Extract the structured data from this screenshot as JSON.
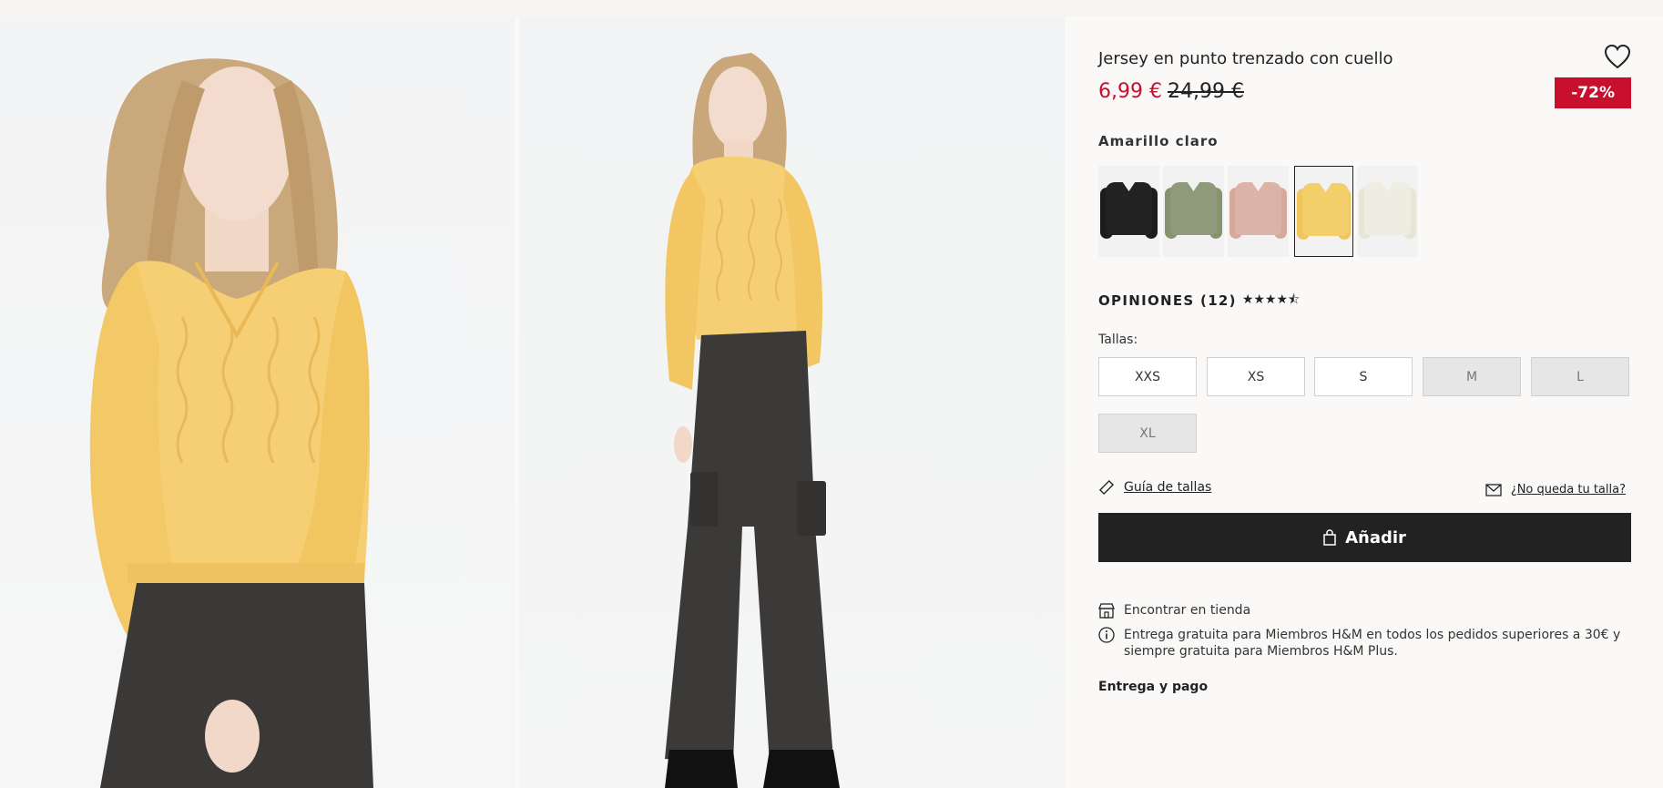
{
  "product": {
    "title": "Jersey en punto trenzado con cuello",
    "price_now": "6,99 €",
    "price_old": "24,99 €",
    "discount_badge": "-72%",
    "color_name": "Amarillo claro",
    "swatches": [
      {
        "name": "black",
        "color": "#1c1c1c"
      },
      {
        "name": "sage",
        "color": "#8e9a7a"
      },
      {
        "name": "pink",
        "color": "#dcb3a9"
      },
      {
        "name": "yellow",
        "color": "#f2cf6a",
        "selected": true
      },
      {
        "name": "cream",
        "color": "#efece1"
      }
    ]
  },
  "reviews": {
    "label": "OPINIONES (12)",
    "stars": "★★★★⯪"
  },
  "sizes": {
    "label": "Tallas:",
    "options": [
      {
        "label": "XXS",
        "available": true
      },
      {
        "label": "XS",
        "available": true
      },
      {
        "label": "S",
        "available": true
      },
      {
        "label": "M",
        "available": false
      },
      {
        "label": "L",
        "available": false
      },
      {
        "label": "XL",
        "available": false
      }
    ]
  },
  "links": {
    "size_guide": "Guía de tallas",
    "no_fit": "¿No queda tu talla?"
  },
  "cta": {
    "add_label": "Añadir"
  },
  "info": {
    "find_store": "Encontrar en tienda",
    "free_delivery_line1": "Entrega gratuita para Miembros H&M en todos los pedidos superiores a 30€ y",
    "free_delivery_line2": "siempre gratuita para Miembros H&M Plus.",
    "delivery_payment": "Entrega y pago"
  },
  "colors": {
    "accent_red": "#c8102e",
    "button_dark": "#222222"
  }
}
